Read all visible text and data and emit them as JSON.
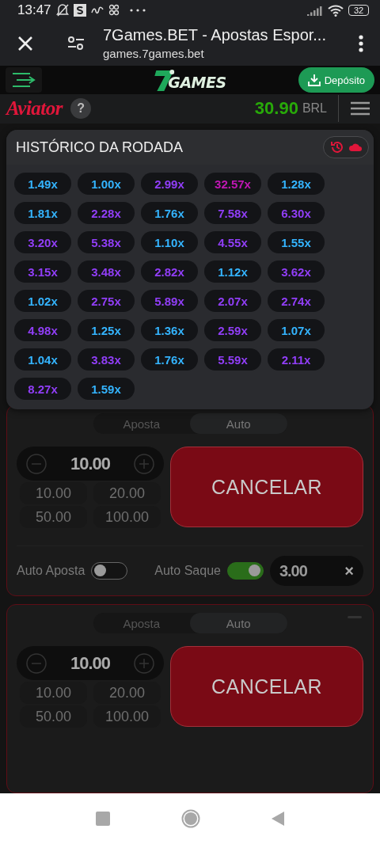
{
  "status_bar": {
    "time": "13:47",
    "battery": "32"
  },
  "browser": {
    "title": "7Games.BET - Apostas Espor...",
    "url": "games.7games.bet"
  },
  "site_header": {
    "logo": "GAMES",
    "deposit_button": "Depósito"
  },
  "game_header": {
    "logo": "Aviator",
    "help": "?",
    "balance": "30.90",
    "currency": "BRL"
  },
  "history": {
    "title": "HISTÓRICO DA RODADA",
    "multipliers": [
      {
        "value": "1.49x",
        "color": "#34b4ff"
      },
      {
        "value": "1.00x",
        "color": "#34b4ff"
      },
      {
        "value": "2.99x",
        "color": "#913ef8"
      },
      {
        "value": "32.57x",
        "color": "#c017b4"
      },
      {
        "value": "1.28x",
        "color": "#34b4ff"
      },
      {
        "value": "1.81x",
        "color": "#34b4ff"
      },
      {
        "value": "2.28x",
        "color": "#913ef8"
      },
      {
        "value": "1.76x",
        "color": "#34b4ff"
      },
      {
        "value": "7.58x",
        "color": "#913ef8"
      },
      {
        "value": "6.30x",
        "color": "#913ef8"
      },
      {
        "value": "3.20x",
        "color": "#913ef8"
      },
      {
        "value": "5.38x",
        "color": "#913ef8"
      },
      {
        "value": "1.10x",
        "color": "#34b4ff"
      },
      {
        "value": "4.55x",
        "color": "#913ef8"
      },
      {
        "value": "1.55x",
        "color": "#34b4ff"
      },
      {
        "value": "3.15x",
        "color": "#913ef8"
      },
      {
        "value": "3.48x",
        "color": "#913ef8"
      },
      {
        "value": "2.82x",
        "color": "#913ef8"
      },
      {
        "value": "1.12x",
        "color": "#34b4ff"
      },
      {
        "value": "3.62x",
        "color": "#913ef8"
      },
      {
        "value": "1.02x",
        "color": "#34b4ff"
      },
      {
        "value": "2.75x",
        "color": "#913ef8"
      },
      {
        "value": "5.89x",
        "color": "#913ef8"
      },
      {
        "value": "2.07x",
        "color": "#913ef8"
      },
      {
        "value": "2.74x",
        "color": "#913ef8"
      },
      {
        "value": "4.98x",
        "color": "#913ef8"
      },
      {
        "value": "1.25x",
        "color": "#34b4ff"
      },
      {
        "value": "1.36x",
        "color": "#34b4ff"
      },
      {
        "value": "2.59x",
        "color": "#913ef8"
      },
      {
        "value": "1.07x",
        "color": "#34b4ff"
      },
      {
        "value": "1.04x",
        "color": "#34b4ff"
      },
      {
        "value": "3.83x",
        "color": "#913ef8"
      },
      {
        "value": "1.76x",
        "color": "#34b4ff"
      },
      {
        "value": "5.59x",
        "color": "#913ef8"
      },
      {
        "value": "2.11x",
        "color": "#913ef8"
      },
      {
        "value": "8.27x",
        "color": "#913ef8"
      },
      {
        "value": "1.59x",
        "color": "#34b4ff"
      }
    ]
  },
  "bet_panels": [
    {
      "tabs": [
        {
          "label": "Aposta",
          "selected": false
        },
        {
          "label": "Auto",
          "selected": true
        }
      ],
      "remove_button": false,
      "amount": "10.00",
      "quick_amounts": [
        "10.00",
        "20.00",
        "50.00",
        "100.00"
      ],
      "action_button": "CANCELAR",
      "auto_bet": {
        "label": "Auto Aposta",
        "on": false
      },
      "auto_cashout": {
        "label": "Auto Saque",
        "on": true,
        "value": "3.00",
        "clear": "×"
      }
    },
    {
      "tabs": [
        {
          "label": "Aposta",
          "selected": false
        },
        {
          "label": "Auto",
          "selected": true
        }
      ],
      "remove_button": true,
      "amount": "10.00",
      "quick_amounts": [
        "10.00",
        "20.00",
        "50.00",
        "100.00"
      ],
      "action_button": "CANCELAR"
    }
  ]
}
